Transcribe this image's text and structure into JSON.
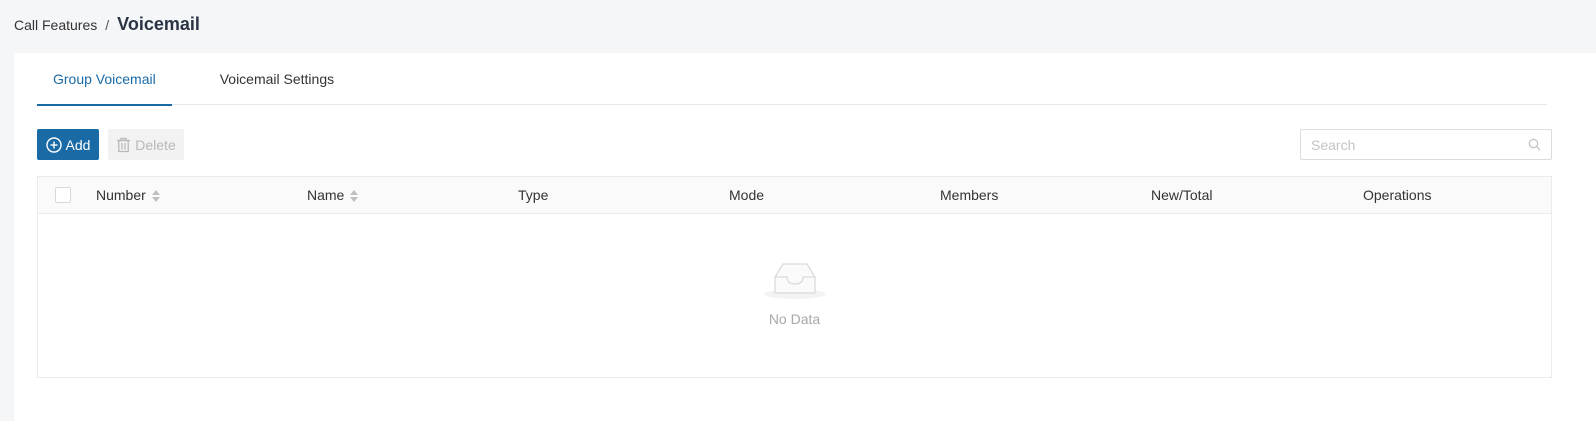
{
  "breadcrumb": {
    "parent": "Call Features",
    "separator": "/",
    "current": "Voicemail"
  },
  "tabs": [
    {
      "label": "Group Voicemail",
      "active": true
    },
    {
      "label": "Voicemail Settings",
      "active": false
    }
  ],
  "toolbar": {
    "add_label": "Add",
    "delete_label": "Delete",
    "search_placeholder": "Search"
  },
  "table": {
    "columns": [
      {
        "label": "Number",
        "sortable": true
      },
      {
        "label": "Name",
        "sortable": true
      },
      {
        "label": "Type",
        "sortable": false
      },
      {
        "label": "Mode",
        "sortable": false
      },
      {
        "label": "Members",
        "sortable": false
      },
      {
        "label": "New/Total",
        "sortable": false
      },
      {
        "label": "Operations",
        "sortable": false
      }
    ],
    "empty_text": "No Data"
  },
  "colors": {
    "accent": "#1a6aa6",
    "disabled_bg": "#f2f2f2",
    "disabled_text": "#b8b8b8",
    "page_bg": "#f5f6f8"
  },
  "icons": {
    "add": "plus-circle-icon",
    "delete": "trash-icon",
    "search": "search-icon",
    "empty": "inbox-icon",
    "sort": "sort-caret-icon"
  }
}
